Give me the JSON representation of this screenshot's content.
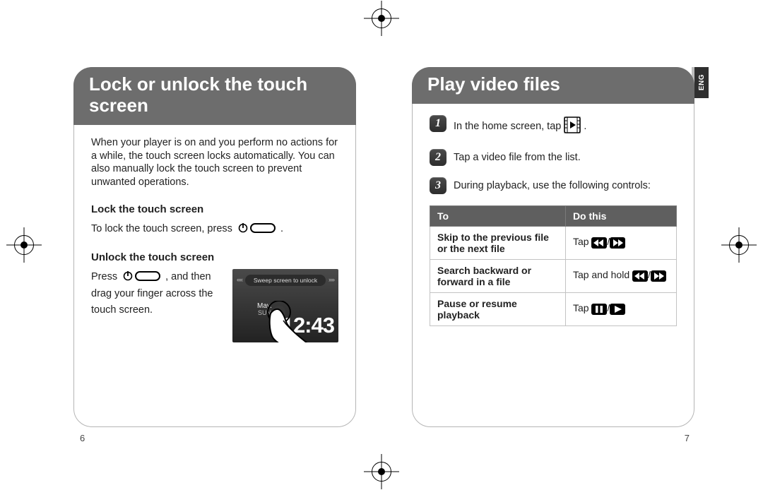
{
  "left": {
    "title": "Lock or unlock the touch\nscreen",
    "intro": "When your player is on and you perform no actions for a while, the touch screen locks automatically. You can also manually lock the touch screen to prevent unwanted operations.",
    "lock_head": "Lock the touch screen",
    "lock_text_a": "To lock the touch screen, press ",
    "lock_text_b": ".",
    "unlock_head": "Unlock the touch screen",
    "unlock_text_a": "Press ",
    "unlock_text_b": ", and then drag your finger across the touch screen.",
    "sweep_label": "Sweep screen to unlock",
    "shot_time": "12:43",
    "shot_month": "May.",
    "shot_day": "SUN",
    "page_num": "6"
  },
  "right": {
    "title": "Play video files",
    "step1_a": "In the home screen, tap ",
    "step1_b": ".",
    "step2": "Tap a video file from the list.",
    "step3": "During playback, use the following controls:",
    "table": {
      "head_to": "To",
      "head_do": "Do this",
      "r1_to": "Skip to the previous file or the next file",
      "r1_do_a": "Tap ",
      "r2_to": "Search backward or forward in a file",
      "r2_do_a": "Tap and hold ",
      "r3_to": "Pause or resume playback",
      "r3_do_a": "Tap "
    },
    "side_tab": "ENG",
    "page_num": "7"
  }
}
